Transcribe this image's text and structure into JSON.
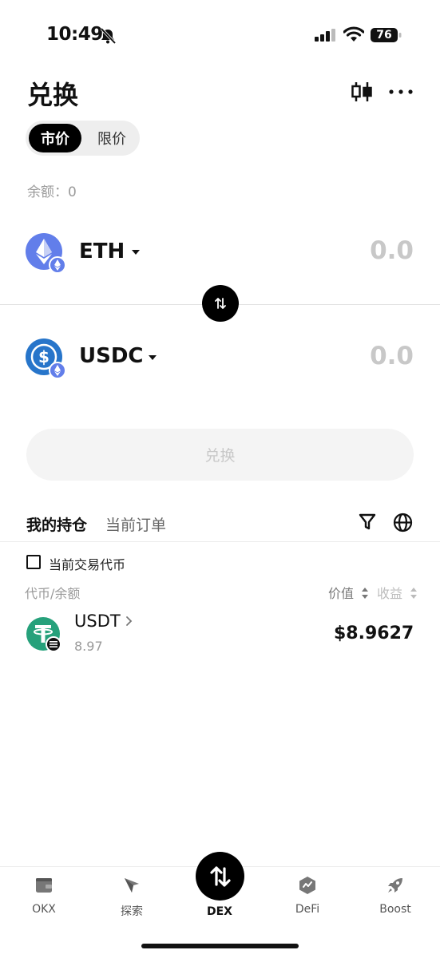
{
  "status_bar": {
    "time": "10:49",
    "battery": "76"
  },
  "header": {
    "title": "兑换"
  },
  "order_type": {
    "active": "市价",
    "inactive": "限价"
  },
  "balance": "余额：0",
  "from_token": {
    "symbol": "ETH",
    "amount": "0.0"
  },
  "to_token": {
    "symbol": "USDC",
    "amount": "0.0"
  },
  "swap_button": "兑换",
  "holdings": {
    "tabs": [
      "我的持仓",
      "当前订单"
    ],
    "filter_checkbox_label": "当前交易代币",
    "columns": {
      "left": "代币/余额",
      "value": "价值",
      "profit": "收益"
    },
    "items": [
      {
        "symbol": "USDT",
        "balance": "8.97",
        "value": "$8.9627"
      }
    ]
  },
  "bottom_nav": {
    "items": [
      {
        "label": "OKX",
        "icon": "wallet-icon"
      },
      {
        "label": "探索",
        "icon": "compass-icon"
      },
      {
        "label": "DEX",
        "icon": "swap-icon"
      },
      {
        "label": "DeFi",
        "icon": "defi-icon"
      },
      {
        "label": "Boost",
        "icon": "rocket-icon"
      }
    ]
  },
  "colors": {
    "eth": "#627EEA",
    "usdc": "#2775CA",
    "usdt": "#26A17B",
    "accent": "#000000"
  }
}
